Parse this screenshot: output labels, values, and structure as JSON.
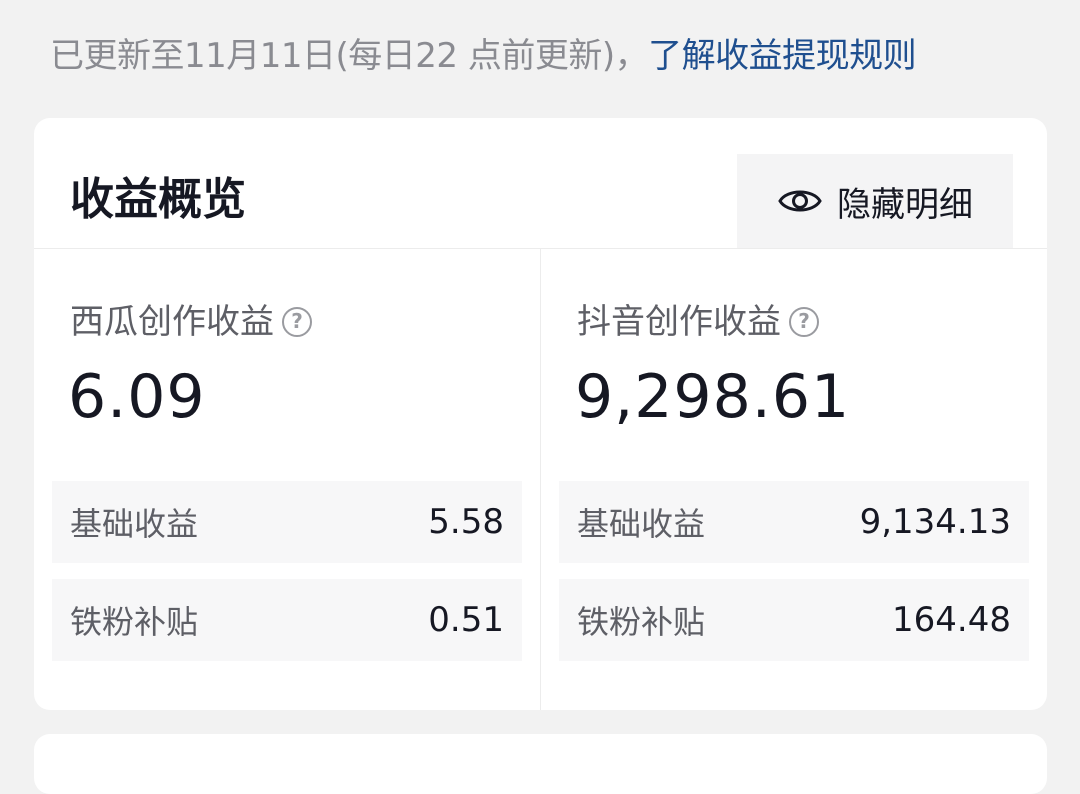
{
  "header": {
    "update_text": "已更新至11月11日(每日22 点前更新)，",
    "rules_link": "了解收益提现规则"
  },
  "overview": {
    "title": "收益概览",
    "hide_details_label": "隐藏明细"
  },
  "xigua": {
    "title": "西瓜创作收益",
    "total": "6.09",
    "rows": [
      {
        "label": "基础收益",
        "value": "5.58"
      },
      {
        "label": "铁粉补贴",
        "value": "0.51"
      }
    ]
  },
  "douyin": {
    "title": "抖音创作收益",
    "total": "9,298.61",
    "rows": [
      {
        "label": "基础收益",
        "value": "9,134.13"
      },
      {
        "label": "铁粉补贴",
        "value": "164.48"
      }
    ]
  },
  "icons": {
    "eye": "eye-icon",
    "help": "question-circle-icon"
  },
  "colors": {
    "link": "#1f4f8f",
    "background": "#f2f2f2",
    "card": "#ffffff",
    "row_bg": "#f7f7f8"
  }
}
